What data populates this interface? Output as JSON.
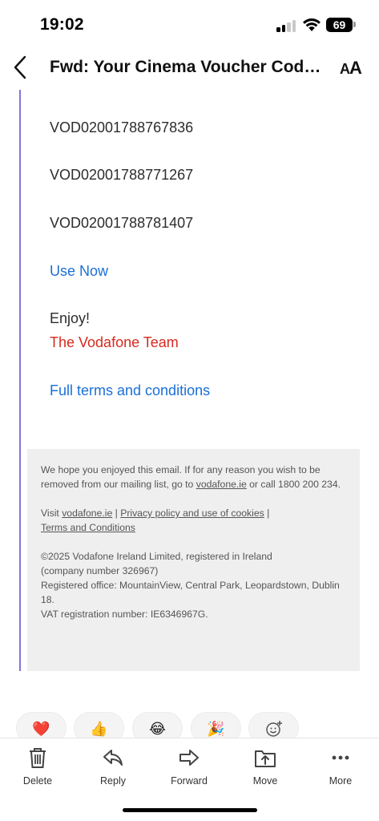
{
  "status_bar": {
    "time": "19:02",
    "battery": "69"
  },
  "header": {
    "subject": "Fwd: Your Cinema Voucher Code...",
    "text_size_icon": "text-size-icon"
  },
  "email": {
    "vouchers": [
      "VOD02001788767836",
      "VOD02001788771267",
      "VOD02001788781407"
    ],
    "use_now": "Use Now",
    "enjoy": "Enjoy!",
    "signature": "The Vodafone Team",
    "terms_link": "Full terms and conditions"
  },
  "footer": {
    "unsubscribe_pre": "We hope you enjoyed this email. If for any reason you wish to be removed from our mailing list, go to ",
    "unsubscribe_link": "vodafone.ie",
    "unsubscribe_post": " or call 1800 200 234.",
    "visit_pre": "Visit ",
    "visit_link": "vodafone.ie",
    "sep1": " | ",
    "privacy_link": "Privacy policy and use of cookies",
    "sep2": " |",
    "terms_link": "Terms and Conditions",
    "copyright": "©2025 Vodafone Ireland Limited, registered in Ireland",
    "company_number": "(company number 326967)",
    "registered_office": "Registered office: MountainView, Central Park, Leopardstown, Dublin 18.",
    "vat": "VAT registration number: IE6346967G."
  },
  "reactions": [
    "❤️",
    "👍",
    "😂",
    "🎉",
    "add-reaction-icon"
  ],
  "toolbar": {
    "delete": "Delete",
    "reply": "Reply",
    "forward": "Forward",
    "move": "Move",
    "more": "More"
  },
  "colors": {
    "link": "#1a6fd8",
    "signature": "#d62a1f",
    "quote_bar": "#8a72d8",
    "footer_bg": "#efefef"
  }
}
